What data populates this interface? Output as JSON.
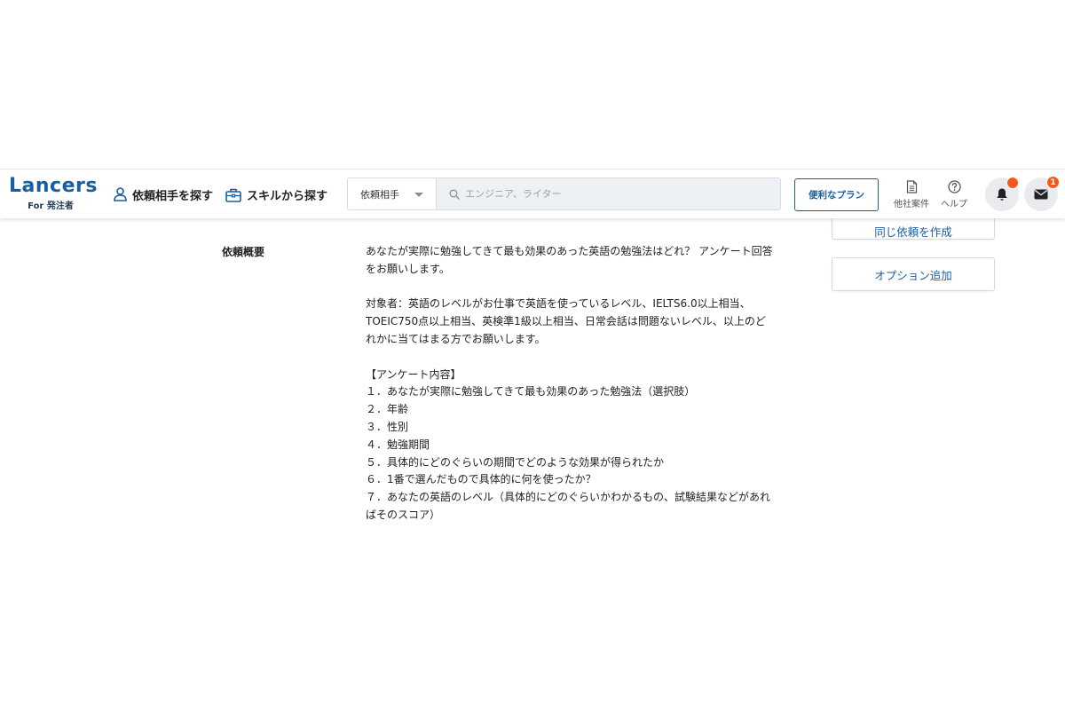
{
  "header": {
    "logo_main": "Lancers",
    "logo_sub": "For 発注者",
    "nav": {
      "find_partner": "依頼相手を探す",
      "find_by_skill": "スキルから探す"
    },
    "search": {
      "category_selected": "依頼相手",
      "placeholder": "エンジニア、ライター"
    },
    "plan_button": "便利なプラン",
    "other_projects": "他社案件",
    "help": "ヘルプ",
    "mail_count": "1"
  },
  "sidebar": {
    "create_same": "同じ依頼を作成",
    "add_option": "オプション追加"
  },
  "main": {
    "overview_label": "依頼概要",
    "paragraphs": {
      "p1": "あなたが実際に勉強してきて最も効果のあった英語の勉強法はどれ？ アンケート回答をお願いします。",
      "p2": "対象者：英語のレベルがお仕事で英語を使っているレベル、IELTS6.0以上相当、TOEIC750点以上相当、英検準1級以上相当、日常会話は問題ないレベル、以上のどれかに当てはまる方でお願いします。",
      "section": "【アンケート内容】",
      "items": [
        "１．あなたが実際に勉強してきて最も効果のあった勉強法（選択肢）",
        "２．年齢",
        "３．性別",
        "４．勉強期間",
        "５．具体的にどのぐらいの期間でどのような効果が得られたか",
        "６．1番で選んだもので具体的に何を使ったか？",
        "７．あなたの英語のレベル（具体的にどのぐらいかわかるもの、試験結果などがあればそのスコア）"
      ]
    }
  },
  "colors": {
    "brand": "#1a5e9e",
    "badge": "#f25a1d"
  },
  "icons": {
    "find_partner": "person-icon",
    "find_by_skill": "briefcase-icon",
    "search": "search-icon",
    "other_projects": "document-icon",
    "help": "question-circle-icon",
    "notifications": "bell-icon",
    "messages": "envelope-icon"
  }
}
